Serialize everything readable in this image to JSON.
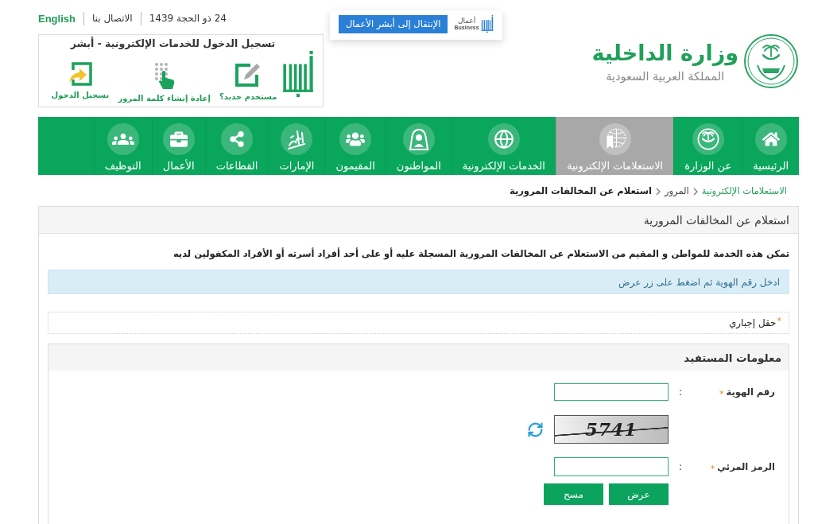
{
  "header": {
    "top_links": [
      {
        "kind": "date",
        "text": "24 ذو الحجة 1439"
      },
      {
        "kind": "link",
        "text": "الاتصال بنا"
      },
      {
        "kind": "language",
        "text": "English"
      }
    ],
    "absher_login": {
      "title": "تسجيل الدخول للخدمات الإلكترونية - أبشر",
      "actions": [
        {
          "kind": "new_user",
          "label": "مستخدم جديد؟"
        },
        {
          "kind": "reset_password",
          "label": "إعادة إنشاء كلمة المرور"
        },
        {
          "kind": "login",
          "label": "تسجيل الدخول"
        }
      ]
    },
    "business_popup": {
      "button": "الإنتقال إلى أبشر الأعمال",
      "logo_arabic": "أعمال",
      "logo_latin": "Business"
    },
    "ministry": {
      "name": "وزارة الداخلية",
      "country": "المملكة العربية السعودية"
    }
  },
  "nav": [
    {
      "kind": "home",
      "label": "الرئيسية",
      "selected": false
    },
    {
      "kind": "ministry",
      "label": "عن الوزارة",
      "selected": false
    },
    {
      "kind": "inquiries",
      "label": "الاستعلامات الإلكترونية",
      "selected": true
    },
    {
      "kind": "services",
      "label": "الخدمات الإلكترونية",
      "selected": false
    },
    {
      "kind": "citizens",
      "label": "المواطنون",
      "selected": false
    },
    {
      "kind": "residents",
      "label": "المقيمون",
      "selected": false
    },
    {
      "kind": "emirates",
      "label": "الإمارات",
      "selected": false
    },
    {
      "kind": "sectors",
      "label": "القطاعات",
      "selected": false
    },
    {
      "kind": "business",
      "label": "الأعمال",
      "selected": false
    },
    {
      "kind": "jobs",
      "label": "التوظيف",
      "selected": false
    }
  ],
  "breadcrumb": [
    {
      "kind": "link",
      "text": "الاستعلامات الإلكترونية"
    },
    {
      "kind": "link",
      "text": "المرور"
    },
    {
      "kind": "current",
      "text": "استعلام عن المخالفات المرورية"
    }
  ],
  "panel": {
    "title": "استعلام عن المخالفات المرورية",
    "description": "تمكن هذه الخدمة للمواطن و المقيم من الاستعلام عن المخالفات المرورية المسجلة عليه أو على أحد أفراد أسرته أو الأفراد المكفولين لديه",
    "alert": "ادخل رقم الهوية ثم اضغط على زر عرض",
    "required_note": {
      "mark": "*",
      "text": "حقل إجباري"
    },
    "section": {
      "title": "معلومات المستفيد",
      "fields": [
        {
          "kind": "input",
          "label": "رقم الهوية",
          "required_mark": "*",
          "separator": ":"
        },
        {
          "kind": "captcha",
          "code": "5741"
        },
        {
          "kind": "input",
          "label": "الرمز المرئي",
          "required_mark": "*",
          "separator": ":"
        }
      ],
      "buttons": [
        "عرض",
        "مسح"
      ]
    }
  }
}
